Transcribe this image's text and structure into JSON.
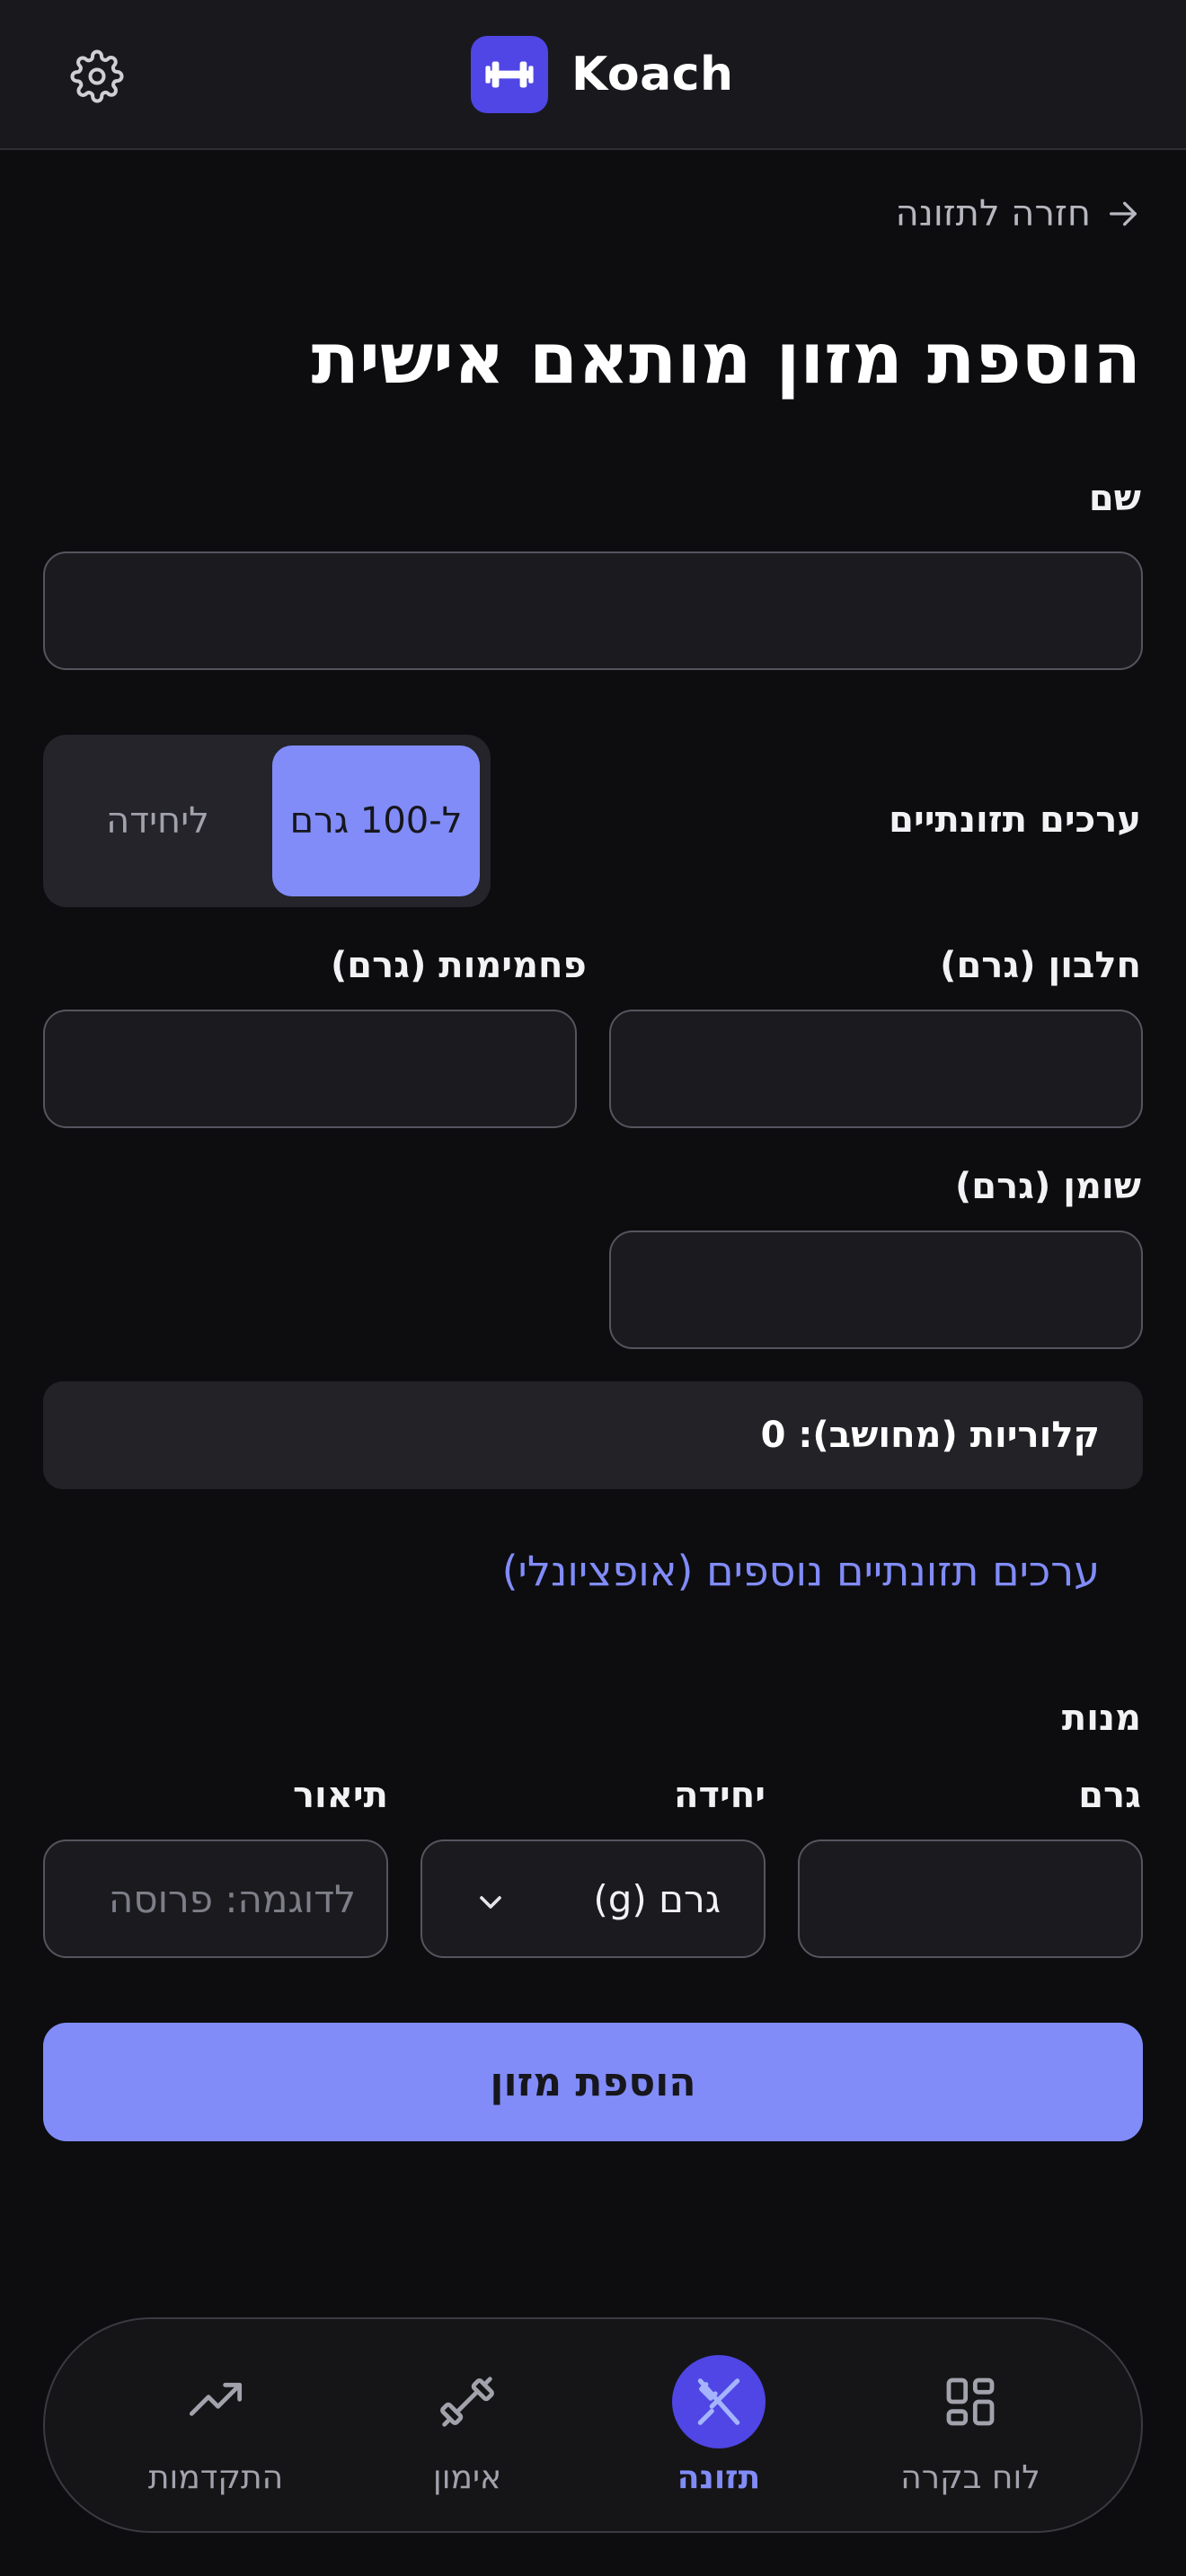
{
  "header": {
    "app_name": "Koach",
    "settings_icon": "gear-icon",
    "logo_icon": "dumbbell-icon"
  },
  "back_link": {
    "label": "חזרה לתזונה",
    "icon": "arrow-right-icon"
  },
  "page_title": "הוספת מזון מותאם אישית",
  "form": {
    "name_label": "שם",
    "name_value": "",
    "nutrition_label": "ערכים תזונתיים",
    "toggle": {
      "per_100g": "ל-100 גרם",
      "per_unit": "ליחידה",
      "selected": "per_100g"
    },
    "protein_label": "חלבון (גרם)",
    "protein_value": "",
    "carbs_label": "פחמימות (גרם)",
    "carbs_value": "",
    "fat_label": "שומן (גרם)",
    "fat_value": "",
    "calories_text": "קלוריות (מחושב): 0",
    "more_nutrients_link": "ערכים תזונתיים נוספים (אופציונלי)",
    "servings_label": "מנות",
    "grams_label": "גרם",
    "grams_value": "",
    "unit_label": "יחידה",
    "unit_selected": "גרם (g)",
    "description_label": "תיאור",
    "description_placeholder": "לדוגמה: פרוסה",
    "submit_label": "הוספת מזון"
  },
  "bottom_nav": {
    "items": [
      {
        "label": "לוח בקרה",
        "icon": "dashboard-grid-icon",
        "active": false
      },
      {
        "label": "תזונה",
        "icon": "utensils-icon",
        "active": true
      },
      {
        "label": "אימון",
        "icon": "dumbbell-icon",
        "active": false
      },
      {
        "label": "התקדמות",
        "icon": "trending-up-icon",
        "active": false
      }
    ]
  },
  "colors": {
    "background": "#0d0d10",
    "header": "#19191d",
    "accent": "#818cf8",
    "brand": "#4f46e5"
  }
}
